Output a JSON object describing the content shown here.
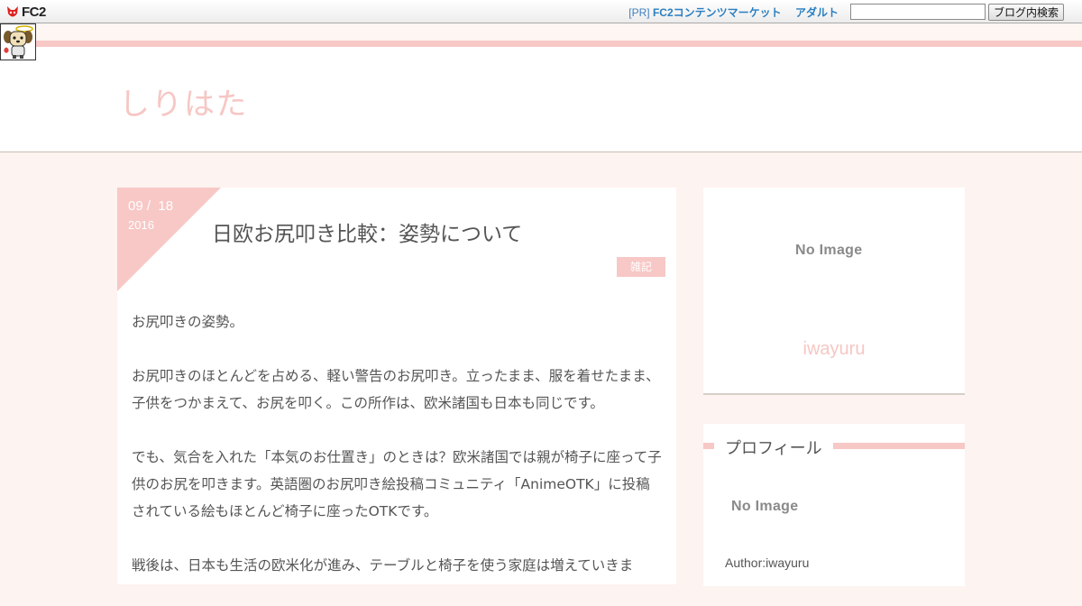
{
  "fc2_bar": {
    "logo_text": "FC2",
    "pr_label": "[PR]",
    "market_link": "FC2コンテンツマーケット",
    "adult_link": "アダルト",
    "search_value": "",
    "search_button": "ブログ内検索"
  },
  "header": {
    "blog_title": "しりはた"
  },
  "article": {
    "date_month": "09",
    "date_day": "18",
    "date_separator": "/",
    "date_year": "2016",
    "title": "日欧お尻叩き比較：姿勢について",
    "category": "雑記",
    "paragraphs": [
      "お尻叩きの姿勢。",
      "お尻叩きのほとんどを占める、軽い警告のお尻叩き。立ったまま、服を着せたまま、子供をつかまえて、お尻を叩く。この所作は、欧米諸国も日本も同じです。",
      "でも、気合を入れた「本気のお仕置き」のときは？欧米諸国では親が椅子に座って子供のお尻を叩きます。英語圏のお尻叩き絵投稿コミュニティ「AnimeOTK」に投稿されている絵もほとんど椅子に座ったOTKです。",
      "戦後は、日本も生活の欧米化が進み、テーブルと椅子を使う家庭は増えていきま"
    ]
  },
  "sidebar": {
    "top_no_image": "No Image",
    "author_name": "iwayuru",
    "profile_heading": "プロフィール",
    "profile_no_image": "No Image",
    "author_label": "Author:iwayuru"
  },
  "colors": {
    "accent_pink": "#f7c8c6",
    "title_pink": "#f6c7c4",
    "background": "#fdf3f0",
    "link_blue": "#2a7fc1"
  }
}
